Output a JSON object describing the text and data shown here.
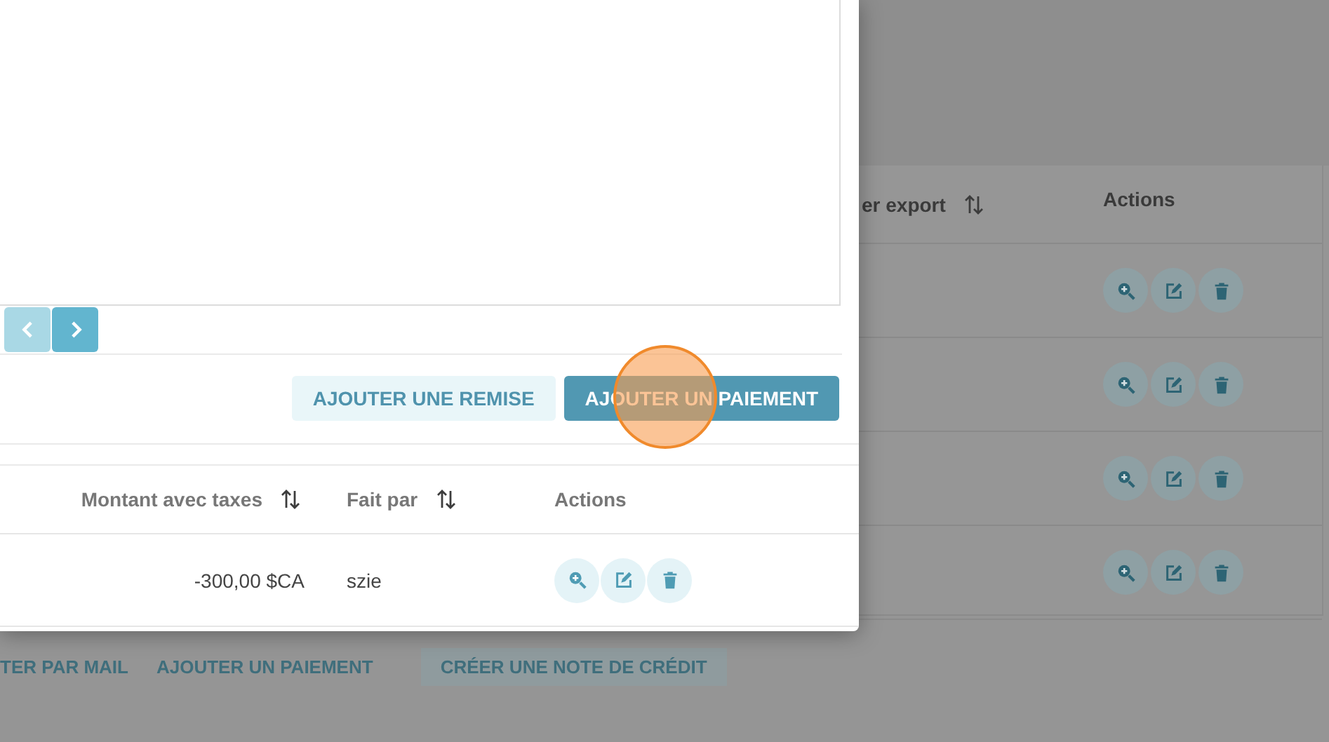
{
  "background": {
    "table": {
      "columns": [
        {
          "label": "er export",
          "sortable": true
        },
        {
          "label": "Actions",
          "sortable": false
        }
      ],
      "rows": [
        {
          "actions": [
            {
              "kind": "view"
            },
            {
              "kind": "edit"
            },
            {
              "kind": "delete"
            }
          ]
        },
        {
          "actions": [
            {
              "kind": "view"
            },
            {
              "kind": "edit"
            },
            {
              "kind": "delete"
            }
          ]
        },
        {
          "actions": [
            {
              "kind": "view"
            },
            {
              "kind": "edit"
            },
            {
              "kind": "delete"
            }
          ]
        },
        {
          "actions": [
            {
              "kind": "view"
            },
            {
              "kind": "edit"
            },
            {
              "kind": "delete"
            }
          ]
        }
      ]
    },
    "footer_buttons": [
      {
        "label": "TER PAR MAIL",
        "kind": "plain"
      },
      {
        "label": "AJOUTER UN PAIEMENT",
        "kind": "plain"
      },
      {
        "label": "CRÉER UNE NOTE DE CRÉDIT",
        "kind": "boxed"
      }
    ]
  },
  "modal": {
    "pagination": [
      {
        "kind": "prev",
        "disabled": true
      },
      {
        "kind": "next",
        "disabled": false
      }
    ],
    "buttons": [
      {
        "label": "AJOUTER UNE REMISE",
        "kind": "secondary"
      },
      {
        "label": "AJOUTER UN PAIEMENT",
        "kind": "primary"
      }
    ],
    "payments_table": {
      "columns": [
        {
          "label": "Montant avec taxes",
          "sortable": true
        },
        {
          "label": "Fait par",
          "sortable": true
        },
        {
          "label": "Actions",
          "sortable": false
        }
      ],
      "rows": [
        {
          "cells": [
            "-300,00 $CA",
            "szie"
          ],
          "actions": [
            {
              "kind": "view"
            },
            {
              "kind": "edit"
            },
            {
              "kind": "delete"
            }
          ]
        }
      ]
    }
  },
  "click_indicator": true
}
